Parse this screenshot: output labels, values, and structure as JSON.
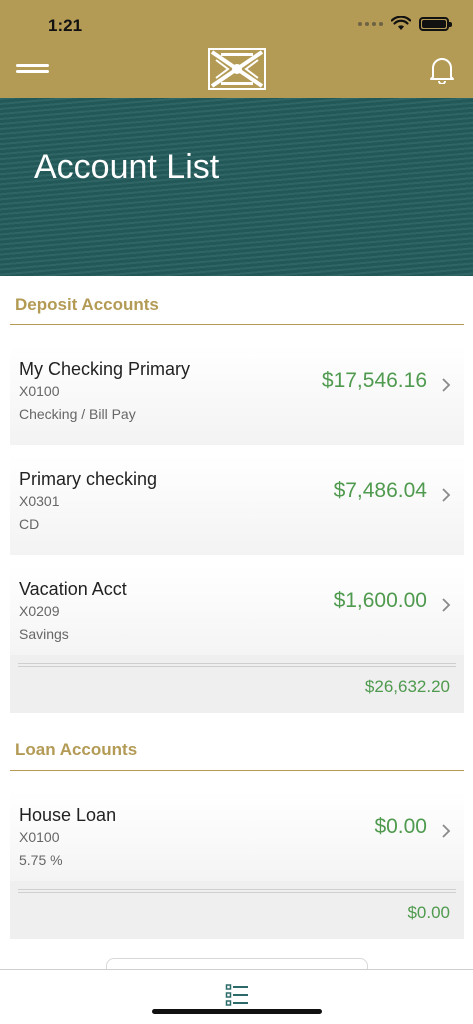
{
  "status": {
    "time": "1:21"
  },
  "header": {
    "title": "Account List"
  },
  "deposit": {
    "header": "Deposit Accounts",
    "accounts": [
      {
        "name": "My Checking Primary",
        "number": "X0100",
        "type": "Checking / Bill Pay",
        "balance": "$17,546.16"
      },
      {
        "name": "Primary checking",
        "number": "X0301",
        "type": "CD",
        "balance": "$7,486.04"
      },
      {
        "name": "Vacation Acct",
        "number": "X0209",
        "type": "Savings",
        "balance": "$1,600.00"
      }
    ],
    "total": "$26,632.20"
  },
  "loan": {
    "header": "Loan Accounts",
    "accounts": [
      {
        "name": "House Loan",
        "number": "X0100",
        "type": "5.75 %",
        "balance": "$0.00"
      }
    ],
    "total": "$0.00"
  },
  "colors": {
    "gold": "#b39a55",
    "teal": "#245d5c",
    "green": "#4f9a4e"
  },
  "icons": {
    "menu": "hamburger-icon",
    "notifications": "bell-icon",
    "tab": "list-icon",
    "row": "chevron-right-icon"
  }
}
